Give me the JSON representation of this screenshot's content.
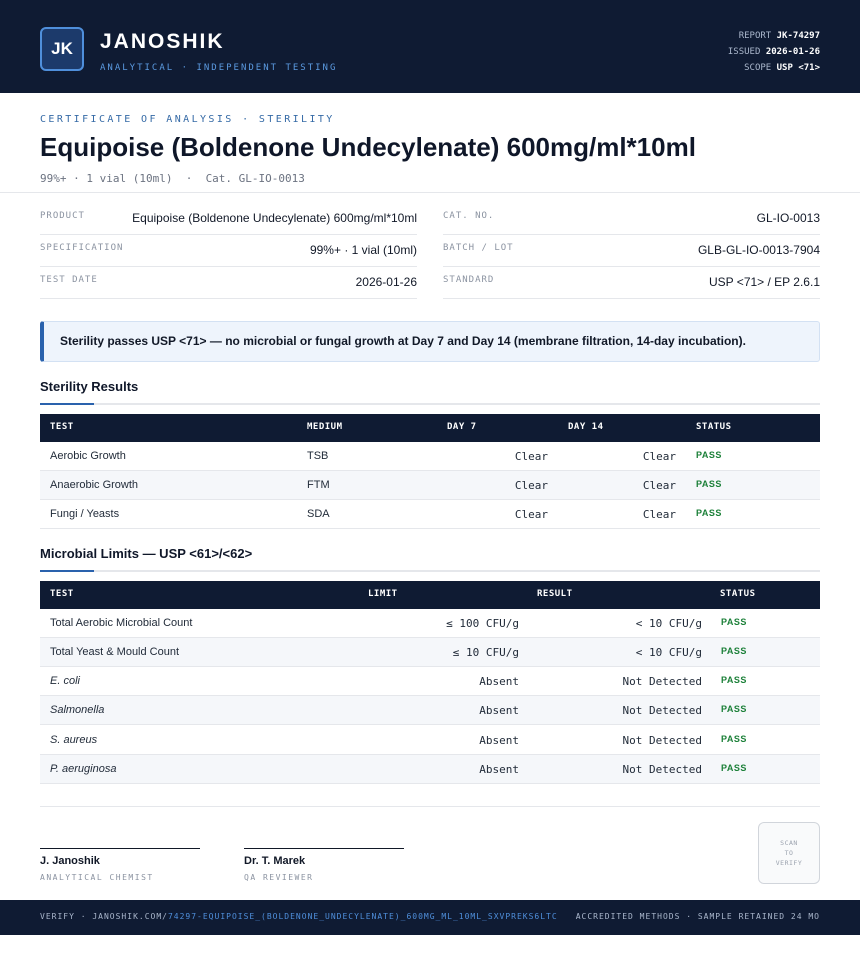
{
  "header": {
    "logo_initials": "JK",
    "brand": "JANOSHIK",
    "tagline": "ANALYTICAL · INDEPENDENT TESTING",
    "meta": [
      {
        "label": "REPORT",
        "value": "JK-74297"
      },
      {
        "label": "ISSUED",
        "value": "2026-01-26"
      },
      {
        "label": "SCOPE",
        "value": "USP <71>"
      }
    ]
  },
  "doc": {
    "kicker": "CERTIFICATE OF ANALYSIS · STERILITY",
    "title": "Equipoise (Boldenone Undecylenate) 600mg/ml*10ml",
    "subtitle": "99%+ · 1 vial (10ml)  ·  Cat. GL-IO-0013"
  },
  "info": {
    "left": [
      {
        "label": "PRODUCT",
        "value": "Equipoise (Boldenone Undecylenate) 600mg/ml*10ml"
      },
      {
        "label": "SPECIFICATION",
        "value": "99%+ · 1 vial (10ml)"
      },
      {
        "label": "TEST DATE",
        "value": "2026-01-26"
      }
    ],
    "right": [
      {
        "label": "CAT. NO.",
        "value": "GL-IO-0013"
      },
      {
        "label": "BATCH / LOT",
        "value": "GLB-GL-IO-0013-7904"
      },
      {
        "label": "STANDARD",
        "value": "USP <71> / EP 2.6.1"
      }
    ]
  },
  "alert": "Sterility passes USP <71> — no microbial or fungal growth at Day 7 and Day 14 (membrane filtration, 14-day incubation).",
  "sterility": {
    "title": "Sterility Results",
    "columns": [
      "TEST",
      "MEDIUM",
      "DAY 7",
      "DAY 14",
      "STATUS"
    ],
    "rows": [
      {
        "test": "Aerobic Growth",
        "medium": "TSB",
        "day7": "Clear",
        "day14": "Clear",
        "status": "PASS"
      },
      {
        "test": "Anaerobic Growth",
        "medium": "FTM",
        "day7": "Clear",
        "day14": "Clear",
        "status": "PASS"
      },
      {
        "test": "Fungi / Yeasts",
        "medium": "SDA",
        "day7": "Clear",
        "day14": "Clear",
        "status": "PASS"
      }
    ]
  },
  "microbial": {
    "title": "Microbial Limits — USP <61>/<62>",
    "columns": [
      "TEST",
      "LIMIT",
      "RESULT",
      "STATUS"
    ],
    "rows": [
      {
        "test": "Total Aerobic Microbial Count",
        "limit": "≤ 100 CFU/g",
        "result": "< 10 CFU/g",
        "status": "PASS"
      },
      {
        "test": "Total Yeast & Mould Count",
        "limit": "≤ 10 CFU/g",
        "result": "< 10 CFU/g",
        "status": "PASS"
      },
      {
        "test": "E. coli",
        "limit": "Absent",
        "result": "Not Detected",
        "status": "PASS"
      },
      {
        "test": "Salmonella",
        "limit": "Absent",
        "result": "Not Detected",
        "status": "PASS"
      },
      {
        "test": "S. aureus",
        "limit": "Absent",
        "result": "Not Detected",
        "status": "PASS"
      },
      {
        "test": "P. aeruginosa",
        "limit": "Absent",
        "result": "Not Detected",
        "status": "PASS"
      }
    ]
  },
  "signatures": [
    {
      "name": "J. Janoshik",
      "role": "ANALYTICAL CHEMIST"
    },
    {
      "name": "Dr. T. Marek",
      "role": "QA REVIEWER"
    }
  ],
  "qr": {
    "line1": "SCAN",
    "line2": "TO",
    "line3": "VERIFY"
  },
  "footer": {
    "verify_prefix": "VERIFY · JANOSHIK.COM/",
    "verify_link": "74297-EQUIPOISE_(BOLDENONE_UNDECYLENATE)_600MG_ML_10ML_SXVPREKS6LTC",
    "right": "ACCREDITED METHODS · SAMPLE RETAINED 24 MO"
  }
}
